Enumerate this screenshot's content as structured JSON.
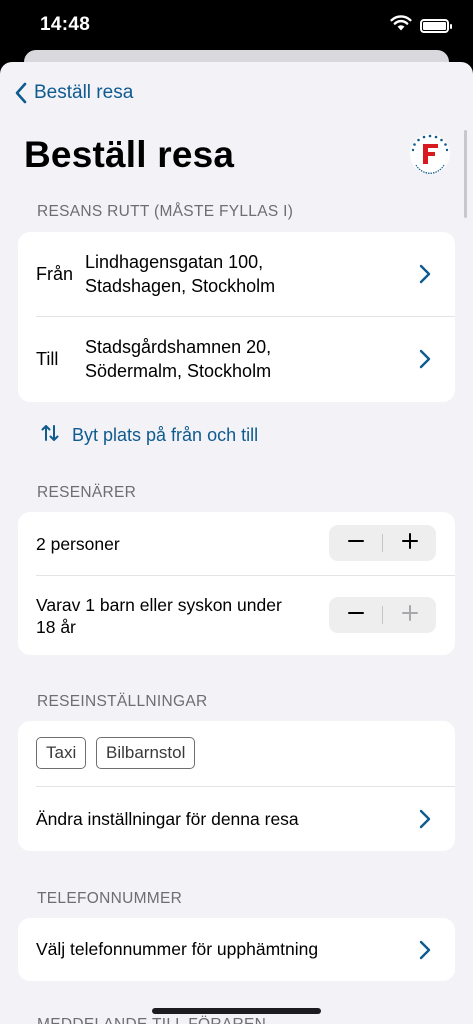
{
  "status_bar": {
    "time": "14:48"
  },
  "nav": {
    "back_label": "Beställ resa"
  },
  "page": {
    "title": "Beställ resa"
  },
  "route": {
    "header": "RESANS RUTT (MÅSTE FYLLAS I)",
    "from_label": "Från",
    "from_address_line1": "Lindhagensgatan 100,",
    "from_address_line2": "Stadshagen, Stockholm",
    "to_label": "Till",
    "to_address_line1": "Stadsgårdshamnen 20,",
    "to_address_line2": "Södermalm, Stockholm",
    "swap_label": "Byt plats på från och till"
  },
  "travelers": {
    "header": "RESENÄRER",
    "persons_label": "2 personer",
    "children_label_line1": "Varav 1 barn eller syskon under",
    "children_label_line2": "18 år"
  },
  "settings": {
    "header": "RESEINSTÄLLNINGAR",
    "chips": [
      "Taxi",
      "Bilbarnstol"
    ],
    "change_label": "Ändra inställningar för denna resa"
  },
  "phone": {
    "header": "TELEFONNUMMER",
    "select_label": "Välj telefonnummer för upphämtning"
  },
  "next_section": {
    "header": "MEDDELANDE TILL FÖRAREN"
  },
  "colors": {
    "accent": "#0f5b8f",
    "background": "#f2f2f7",
    "logo_red": "#d71920"
  }
}
